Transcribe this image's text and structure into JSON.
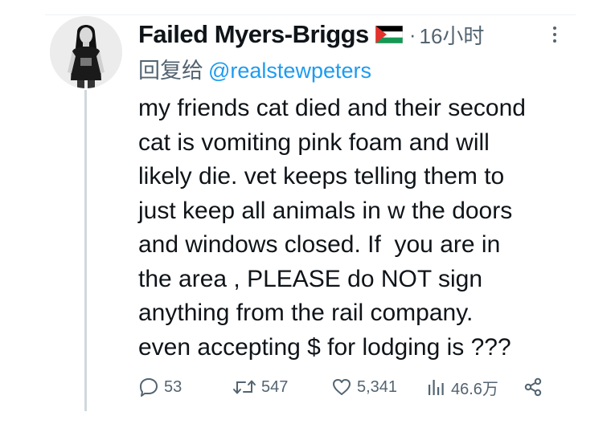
{
  "tweet": {
    "display_name": "Failed Myers-Briggs",
    "flag_icon": "palestine-flag-icon",
    "separator": "·",
    "time": "16小时",
    "reply_prefix": "回复给",
    "reply_handle": "@realstewpeters",
    "text_lines": [
      "my friends cat died and their second",
      "cat is vomiting pink foam and will",
      "likely die. vet keeps telling them to",
      "just keep all animals in w the doors",
      "and windows closed. If  you are in",
      "the area , PLEASE do NOT sign",
      "anything from the rail company.",
      "even accepting $ for lodging is ???"
    ]
  },
  "actions": {
    "replies": "53",
    "retweets": "547",
    "likes": "5,341",
    "views": "46.6万"
  },
  "icons": {
    "reply": "comment-bubble-icon",
    "retweet": "retweet-icon",
    "like": "heart-icon",
    "views": "bar-chart-icon",
    "share": "share-icon",
    "more": "more-vertical-icon"
  },
  "colors": {
    "text": "#0f1419",
    "secondary": "#536471",
    "link": "#1d9bf0",
    "thread_line": "#cfd9de"
  }
}
